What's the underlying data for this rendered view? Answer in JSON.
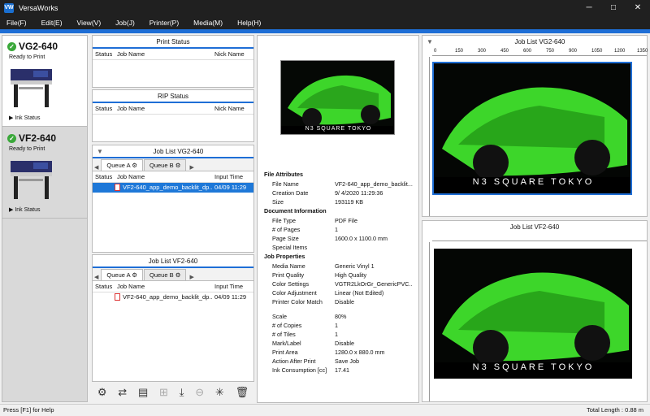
{
  "window": {
    "title": "VersaWorks",
    "min": "─",
    "max": "□",
    "close": "✕"
  },
  "menu": [
    "File(F)",
    "Edit(E)",
    "View(V)",
    "Job(J)",
    "Printer(P)",
    "Media(M)",
    "Help(H)"
  ],
  "printers": [
    {
      "name": "VG2-640",
      "status": "Ready to Print",
      "ink": "Ink Status"
    },
    {
      "name": "VF2-640",
      "status": "Ready to Print",
      "ink": "Ink Status"
    }
  ],
  "print_status": {
    "title": "Print Status",
    "cols": [
      "Status",
      "Job Name",
      "Nick Name"
    ]
  },
  "rip_status": {
    "title": "RIP Status",
    "cols": [
      "Status",
      "Job Name",
      "Nick Name"
    ]
  },
  "joblist1": {
    "title": "Job List VG2-640",
    "tabs": [
      "Queue A",
      "Queue B"
    ],
    "cols": [
      "Status",
      "Job Name",
      "Input Time"
    ],
    "rows": [
      {
        "name": "VF2-640_app_demo_backlit_dp...",
        "time": "04/09 11:29"
      }
    ]
  },
  "joblist2": {
    "title": "Job List VF2-640",
    "tabs": [
      "Queue A",
      "Queue B"
    ],
    "cols": [
      "Status",
      "Job Name",
      "Input Time"
    ],
    "rows": [
      {
        "name": "VF2-640_app_demo_backlit_dp...",
        "time": "04/09 11:29"
      }
    ]
  },
  "attrs": {
    "file_title": "File Attributes",
    "file": [
      [
        "File Name",
        "VF2-640_app_demo_backlit..."
      ],
      [
        "Creation Date",
        "9/ 4/2020 11:29:36"
      ],
      [
        "Size",
        "193119 KB"
      ]
    ],
    "doc_title": "Document Information",
    "doc": [
      [
        "File Type",
        "PDF File"
      ],
      [
        "# of Pages",
        "1"
      ],
      [
        "Page Size",
        "1600.0 x 1100.0 mm"
      ],
      [
        "Special Items",
        ""
      ]
    ],
    "job_title": "Job Properties",
    "job": [
      [
        "Media Name",
        "Generic Vinyl 1"
      ],
      [
        "Print Quality",
        "High Quality"
      ],
      [
        "Color Settings",
        "VGTR2LkOrGr_GenericPVC..."
      ],
      [
        "Color Adjustment",
        "Linear (Not Edited)"
      ],
      [
        "Printer Color Match",
        "Disable"
      ]
    ],
    "job2": [
      [
        "Scale",
        "80%"
      ],
      [
        "# of Copies",
        "1"
      ],
      [
        "# of Tiles",
        "1"
      ],
      [
        "Mark/Label",
        "Disable"
      ],
      [
        "Print Area",
        "1280.0 x 880.0 mm"
      ],
      [
        "Action After Print",
        "Save Job"
      ],
      [
        "Ink Consumption [cc]",
        "17.41"
      ]
    ]
  },
  "preview1": {
    "title": "Job List VG2-640",
    "ruler": [
      "0",
      "150",
      "300",
      "450",
      "600",
      "750",
      "900",
      "1050",
      "1200",
      "1350"
    ]
  },
  "preview2": {
    "title": "Job List VF2-640"
  },
  "car_text": "N3 SQUARE TOKYO",
  "status": {
    "left": "Press [F1] for Help",
    "right": "Total Length : 0.88 m"
  }
}
